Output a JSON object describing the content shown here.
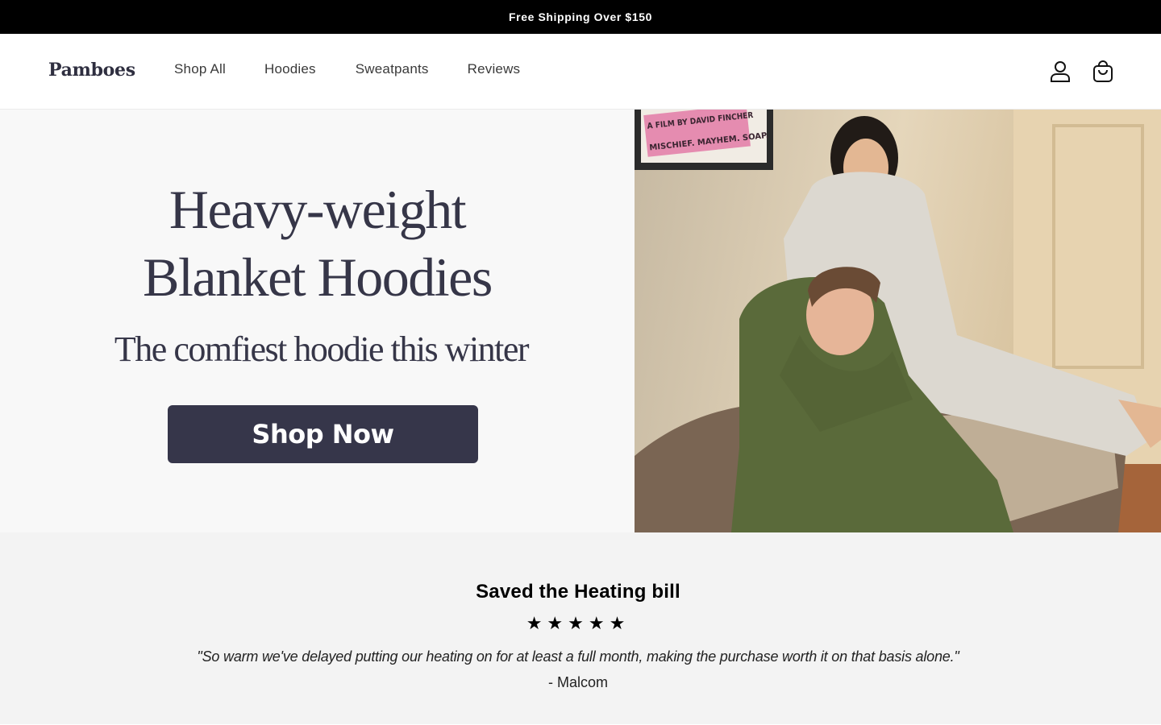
{
  "announcement": "Free Shipping Over $150",
  "header": {
    "logo": "Pamboes",
    "nav": [
      "Shop All",
      "Hoodies",
      "Sweatpants",
      "Reviews"
    ],
    "icons": {
      "account": "account-icon",
      "cart": "cart-icon"
    }
  },
  "hero": {
    "title_line1": "Heavy-weight",
    "title_line2": "Blanket Hoodies",
    "subtitle": "The comfiest hoodie this winter",
    "cta": "Shop Now",
    "poster_line1": "A FILM BY DAVID FINCHER",
    "poster_line2": "MISCHIEF. MAYHEM. SOAP."
  },
  "review": {
    "title": "Saved the Heating bill",
    "stars": "★★★★★",
    "quote": "\"So warm we've delayed putting our heating on for at least a full month, making the purchase worth it on that basis alone.\"",
    "author": "- Malcom"
  },
  "colors": {
    "announcement_bg": "#000000",
    "brand_navy": "#36364a",
    "hero_left_bg": "#f8f8f8",
    "review_bg": "#f3f3f3"
  }
}
